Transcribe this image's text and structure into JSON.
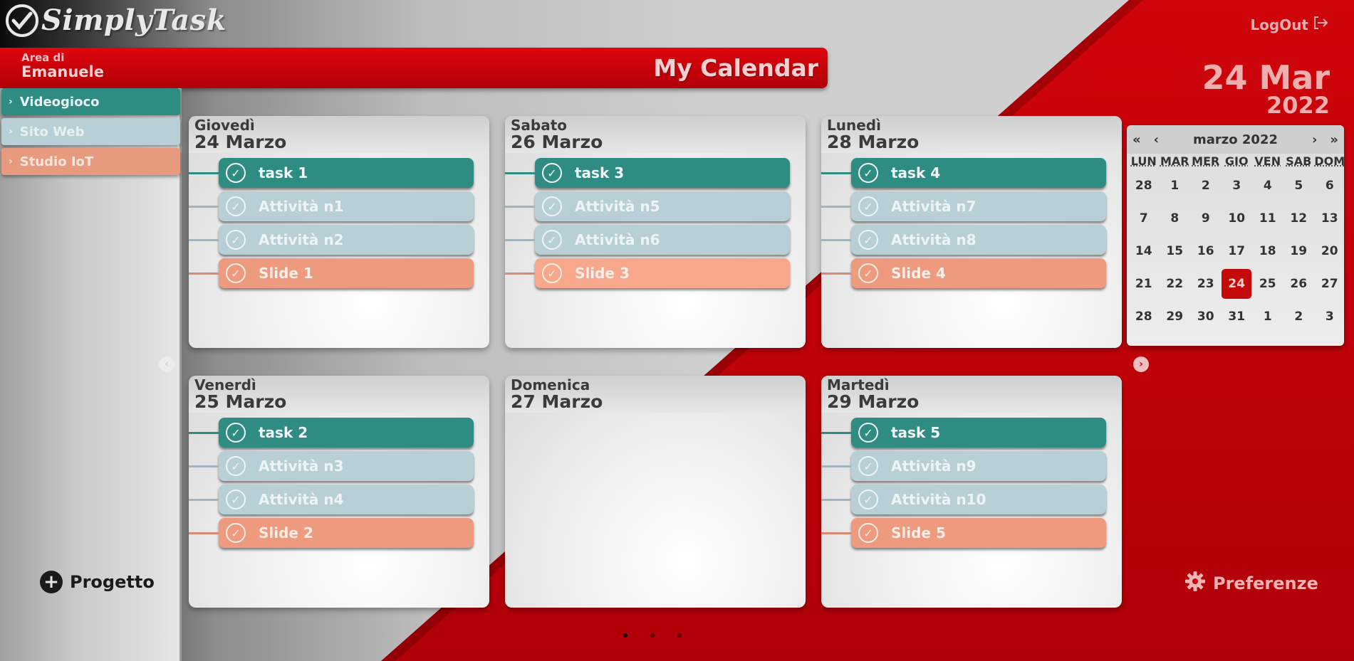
{
  "app": {
    "logo_text": "SimplyTask",
    "logout_label": "LogOut"
  },
  "header": {
    "area_label": "Area di",
    "user_name": "Emanuele",
    "title": "My Calendar"
  },
  "today": {
    "day_month": "24 Mar",
    "year": "2022"
  },
  "projects": [
    {
      "label": "Videogioco",
      "color": "#2f8c83"
    },
    {
      "label": "Sito Web",
      "color": "#b9cfd6"
    },
    {
      "label": "Studio IoT",
      "color": "#e89a7e"
    }
  ],
  "add_project_label": "Progetto",
  "preferences_label": "Preferenze",
  "days": [
    {
      "dow": "Giovedì",
      "date": "24 Marzo",
      "tasks": [
        "task 1",
        "Attività n1",
        "Attività n2",
        "Slide 1"
      ]
    },
    {
      "dow": "Sabato",
      "date": "26 Marzo",
      "tasks": [
        "task 3",
        "Attività n5",
        "Attività n6",
        "Slide 3"
      ]
    },
    {
      "dow": "Lunedì",
      "date": "28 Marzo",
      "tasks": [
        "task 4",
        "Attività n7",
        "Attività n8",
        "Slide 4"
      ]
    },
    {
      "dow": "Venerdì",
      "date": "25 Marzo",
      "tasks": [
        "task 2",
        "Attività n3",
        "Attività n4",
        "Slide 2"
      ]
    },
    {
      "dow": "Domenica",
      "date": "27 Marzo",
      "tasks": []
    },
    {
      "dow": "Martedì",
      "date": "29 Marzo",
      "tasks": [
        "task 5",
        "Attività n9",
        "Attività n10",
        "Slide 5"
      ]
    }
  ],
  "mini_calendar": {
    "month_label": "marzo 2022",
    "nav": {
      "first": "«",
      "prev": "‹",
      "next": "›",
      "last": "»"
    },
    "weekdays": [
      "LUN",
      "MAR",
      "MER",
      "GIO",
      "VEN",
      "SAB",
      "DOM"
    ],
    "weeks": [
      [
        "28",
        "1",
        "2",
        "3",
        "4",
        "5",
        "6"
      ],
      [
        "7",
        "8",
        "9",
        "10",
        "11",
        "12",
        "13"
      ],
      [
        "14",
        "15",
        "16",
        "17",
        "18",
        "19",
        "20"
      ],
      [
        "21",
        "22",
        "23",
        "24",
        "25",
        "26",
        "27"
      ],
      [
        "28",
        "29",
        "30",
        "31",
        "1",
        "2",
        "3"
      ]
    ],
    "selected": "24"
  },
  "pagination": {
    "pages": 3,
    "active": 1
  }
}
